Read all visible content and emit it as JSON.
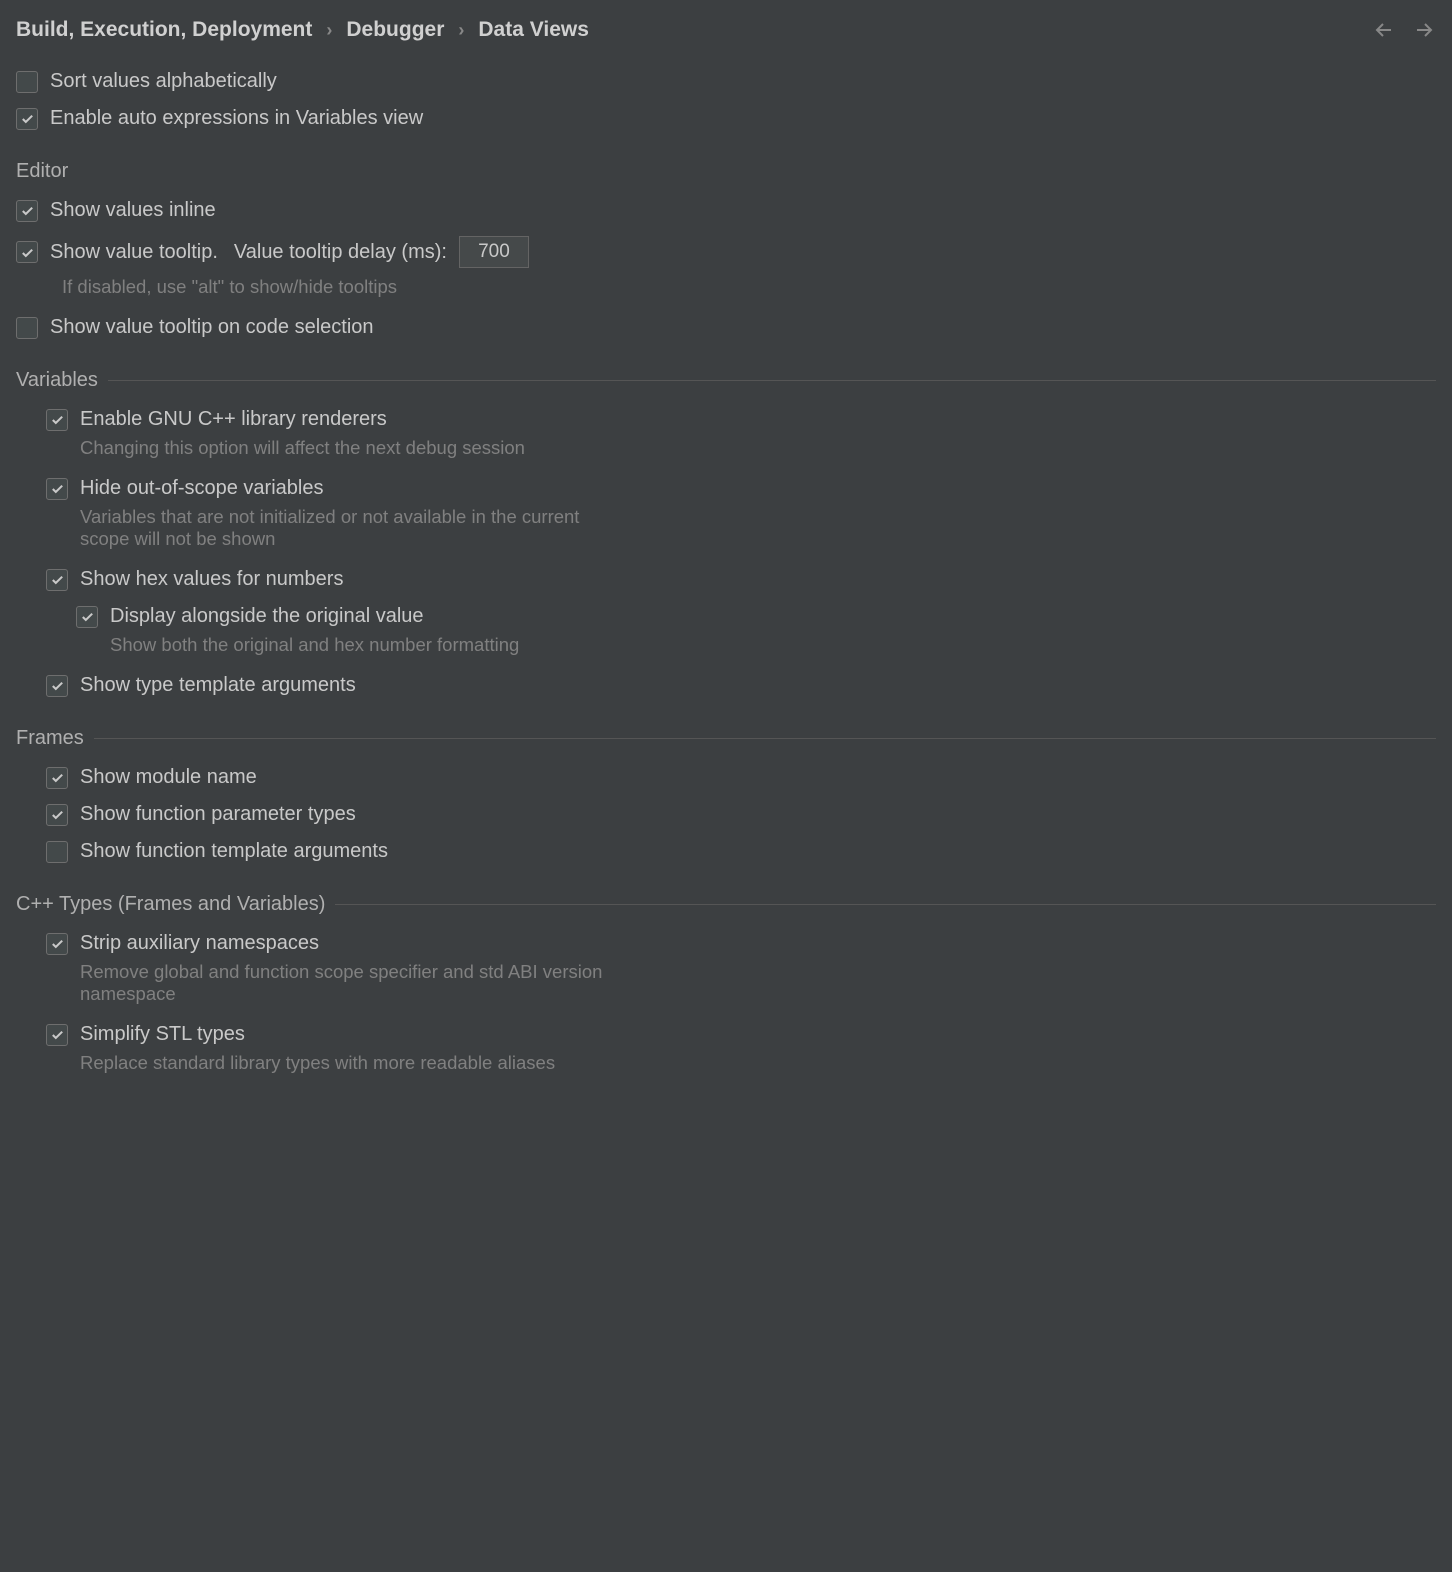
{
  "breadcrumb": {
    "item1": "Build, Execution, Deployment",
    "item2": "Debugger",
    "item3": "Data Views"
  },
  "options": {
    "sort_alpha": "Sort values alphabetically",
    "auto_expr": "Enable auto expressions in Variables view"
  },
  "editor": {
    "title": "Editor",
    "show_inline": "Show values inline",
    "show_tooltip": "Show value tooltip.",
    "tooltip_delay_label": "Value tooltip delay (ms):",
    "tooltip_delay_value": "700",
    "tooltip_help": "If disabled, use \"alt\" to show/hide tooltips",
    "show_tooltip_selection": "Show value tooltip on code selection"
  },
  "variables": {
    "title": "Variables",
    "gnu_renderers": "Enable GNU C++ library renderers",
    "gnu_help": "Changing this option will affect the next debug session",
    "hide_scope": "Hide out-of-scope variables",
    "hide_scope_help": "Variables that are not initialized or not available in the current scope will not be shown",
    "show_hex": "Show hex values for numbers",
    "display_alongside": "Display alongside the original value",
    "display_alongside_help": "Show both the original and hex number formatting",
    "show_template_args": "Show type template arguments"
  },
  "frames": {
    "title": "Frames",
    "show_module": "Show module name",
    "show_param_types": "Show function parameter types",
    "show_template_args": "Show function template arguments"
  },
  "cpptypes": {
    "title": "C++ Types (Frames and Variables)",
    "strip_ns": "Strip auxiliary namespaces",
    "strip_ns_help": "Remove global and function scope specifier and std ABI version namespace",
    "simplify_stl": "Simplify STL types",
    "simplify_stl_help": "Replace standard library types with more readable aliases"
  }
}
